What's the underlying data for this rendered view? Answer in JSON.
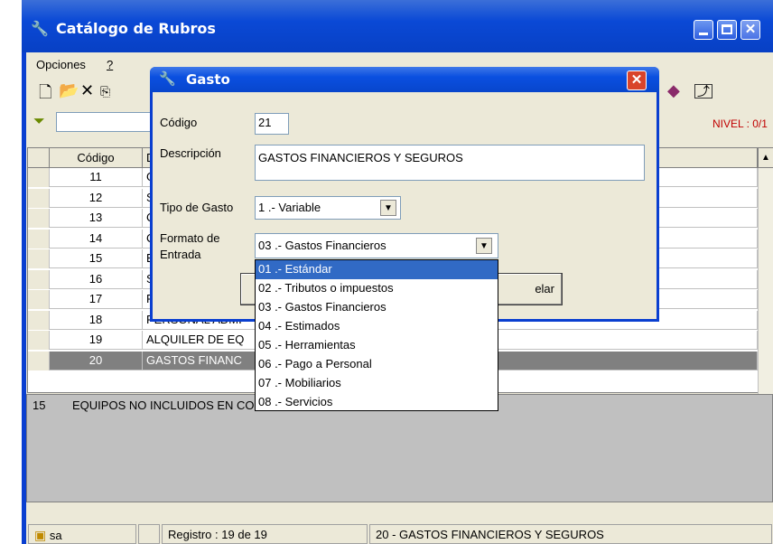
{
  "main_window": {
    "title": "Catálogo de Rubros",
    "menu": [
      "Opciones",
      "?"
    ],
    "nivel": "NIVEL : 0/1"
  },
  "grid": {
    "headers": [
      "Código",
      "D"
    ],
    "rows": [
      {
        "codigo": "11",
        "descripcion": "G"
      },
      {
        "codigo": "12",
        "descripcion": "S"
      },
      {
        "codigo": "13",
        "descripcion": "C"
      },
      {
        "codigo": "14",
        "descripcion": "C"
      },
      {
        "codigo": "15",
        "descripcion": "E"
      },
      {
        "codigo": "16",
        "descripcion": "S"
      },
      {
        "codigo": "17",
        "descripcion": "PERSONAL PROF"
      },
      {
        "codigo": "18",
        "descripcion": "PERSONAL ADMI"
      },
      {
        "codigo": "19",
        "descripcion": "ALQUILER DE EQ"
      },
      {
        "codigo": "20",
        "descripcion": "GASTOS FINANC"
      }
    ]
  },
  "detail": {
    "codigo": "15",
    "texto": "EQUIPOS NO INCLUIDOS EN COSTO DIRECTO"
  },
  "status": {
    "user": "sa",
    "registro_label": "Registro :",
    "registro_value": "19 de 19",
    "current": "20 - GASTOS FINANCIEROS Y SEGUROS"
  },
  "dialog": {
    "title": "Gasto",
    "codigo_label": "Código",
    "codigo_value": "21",
    "descripcion_label": "Descripción",
    "descripcion_value": "GASTOS FINANCIEROS Y SEGUROS",
    "tipo_label": "Tipo de Gasto",
    "tipo_value": "1 .- Variable",
    "formato_label_1": "Formato de",
    "formato_label_2": "Entrada",
    "formato_value": "03 .- Gastos Financieros",
    "cancel_partial": "elar"
  },
  "dropdown": {
    "options": [
      "01 .- Estándar",
      "02 .- Tributos o impuestos",
      "03 .- Gastos Financieros",
      "04 .- Estimados",
      "05 .- Herramientas",
      "06 .- Pago a Personal",
      "07 .- Mobiliarios",
      "08 .- Servicios"
    ],
    "selected_index": 0
  },
  "colors": {
    "title_blue": "#0a49d6",
    "selection_blue": "#316ac5",
    "nivel_red": "#c00000",
    "grid_selected": "#808080"
  },
  "icons": {
    "app_icon": "app-icon",
    "new_icon": "new-doc-icon",
    "open_icon": "open-folder-icon",
    "delete_icon": "delete-icon",
    "copy_icon": "copy-icon",
    "filter_icon": "filter-icon",
    "book_icon": "book-icon",
    "export_icon": "export-icon",
    "user_icon": "user-icon"
  }
}
